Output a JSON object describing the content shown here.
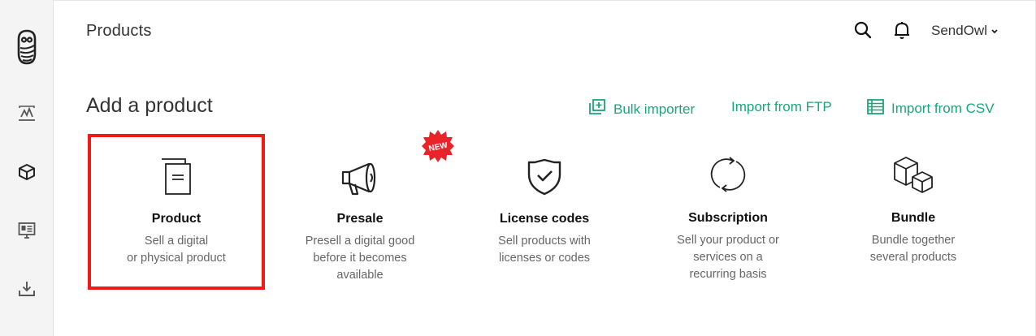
{
  "header": {
    "title": "Products",
    "account_label": "SendOwl"
  },
  "sidebar": {
    "items": [
      {
        "icon": "owl-logo-icon"
      },
      {
        "icon": "analytics-icon"
      },
      {
        "icon": "box-icon"
      },
      {
        "icon": "storefront-icon"
      },
      {
        "icon": "download-icon"
      }
    ]
  },
  "main": {
    "section_title": "Add a product",
    "actions": [
      {
        "label": "Bulk importer",
        "icon": "bulk-import-icon"
      },
      {
        "label": "Import from FTP"
      },
      {
        "label": "Import from CSV",
        "icon": "csv-table-icon"
      }
    ],
    "badge_text": "NEW",
    "cards": [
      {
        "title": "Product",
        "desc_lines": [
          "Sell a digital",
          "or physical product"
        ],
        "icon": "document-icon"
      },
      {
        "title": "Presale",
        "desc_lines": [
          "Presell a digital good",
          "before it becomes",
          "available"
        ],
        "icon": "megaphone-icon"
      },
      {
        "title": "License codes",
        "desc_lines": [
          "Sell products with",
          "licenses or codes"
        ],
        "icon": "shield-check-icon"
      },
      {
        "title": "Subscription",
        "desc_lines": [
          "Sell your product or",
          "services on a",
          "recurring basis"
        ],
        "icon": "recurring-icon"
      },
      {
        "title": "Bundle",
        "desc_lines": [
          "Bundle together",
          "several products"
        ],
        "icon": "boxes-icon"
      }
    ]
  },
  "colors": {
    "accent": "#1aa57a",
    "selection": "#ee1c12",
    "badge": "#e8242a"
  }
}
